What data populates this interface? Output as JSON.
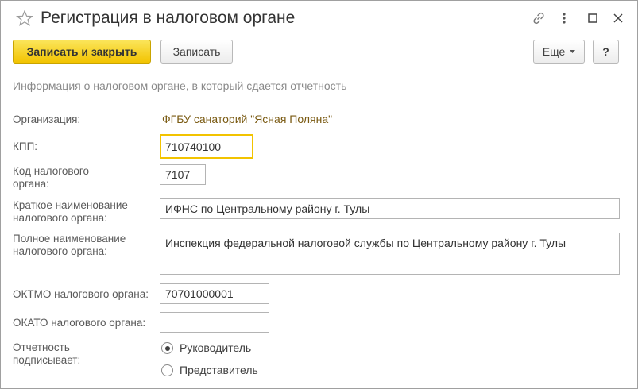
{
  "window": {
    "title": "Регистрация в налоговом органе"
  },
  "toolbar": {
    "save_close_label": "Записать и закрыть",
    "save_label": "Записать",
    "more_label": "Еще",
    "help_label": "?"
  },
  "form": {
    "info_text": "Информация о налоговом органе, в который сдается отчетность",
    "organization": {
      "label": "Организация:",
      "value": "ФГБУ санаторий \"Ясная Поляна\""
    },
    "kpp": {
      "label": "КПП:",
      "value": "710740100"
    },
    "tax_code": {
      "label_line1": "Код налогового",
      "label_line2": "органа:",
      "value": "7107"
    },
    "short_name": {
      "label_line1": "Краткое наименование",
      "label_line2": "налогового органа:",
      "value": "ИФНС по Центральному району г. Тулы"
    },
    "full_name": {
      "label_line1": "Полное наименование",
      "label_line2": "налогового органа:",
      "value": "Инспекция федеральной налоговой службы по Центральному району г. Тулы"
    },
    "oktmo": {
      "label": "ОКТМО налогового органа:",
      "value": "70701000001"
    },
    "okato": {
      "label": "ОКАТО налогового органа:",
      "value": ""
    },
    "signer": {
      "label_line1": "Отчетность",
      "label_line2": "подписывает:",
      "options": [
        {
          "label": "Руководитель",
          "selected": true
        },
        {
          "label": "Представитель",
          "selected": false
        }
      ]
    }
  }
}
